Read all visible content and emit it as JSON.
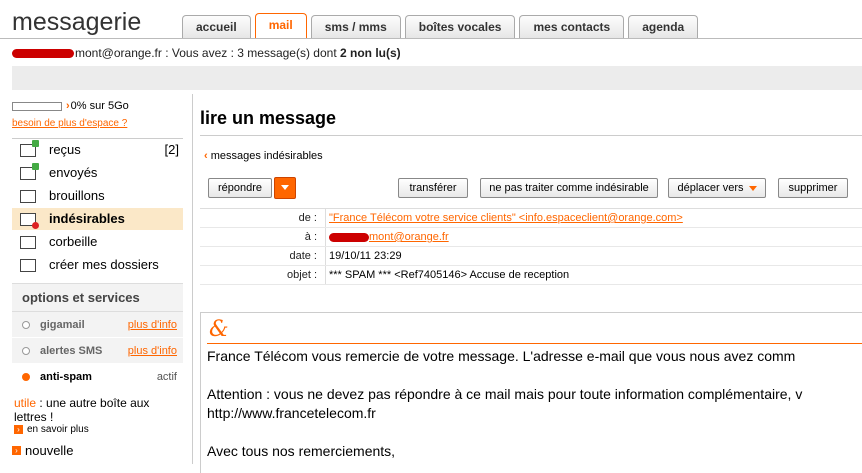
{
  "app": {
    "logo": "messagerie"
  },
  "tabs": [
    "accueil",
    "mail",
    "sms / mms",
    "boîtes vocales",
    "mes contacts",
    "agenda"
  ],
  "active_tab": "mail",
  "user": {
    "email_suffix": "mont@orange.fr",
    "status_text": " : Vous avez : 3 message(s) dont ",
    "unread": "2 non lu(s)"
  },
  "quota": {
    "value": 0,
    "text": "0% sur 5Go",
    "more_link": "besoin de plus d'espace ?"
  },
  "folders": [
    {
      "label": "reçus",
      "count": "[2]",
      "icon": "inbox-icon"
    },
    {
      "label": "envoyés",
      "count": "",
      "icon": "sent-icon"
    },
    {
      "label": "brouillons",
      "count": "",
      "icon": "draft-icon"
    },
    {
      "label": "indésirables",
      "count": "",
      "icon": "spam-icon"
    },
    {
      "label": "corbeille",
      "count": "",
      "icon": "trash-icon"
    },
    {
      "label": "créer mes dossiers",
      "count": "",
      "icon": "folder-icon"
    }
  ],
  "options": {
    "title": "options et services",
    "items": [
      {
        "label": "gigamail",
        "right": "plus d'info"
      },
      {
        "label": "alertes SMS",
        "right": "plus d'info"
      },
      {
        "label": "anti-spam",
        "right": "actif"
      }
    ]
  },
  "promo": {
    "prefix": "utile",
    "text": " : une autre boîte aux lettres !",
    "link": "en savoir plus",
    "next": "nouvelle"
  },
  "message": {
    "page_title": "lire un message",
    "back": "messages indésirables",
    "buttons": {
      "reply": "répondre",
      "forward": "transférer",
      "not_spam": "ne pas traiter comme indésirable",
      "move": "déplacer vers",
      "delete": "supprimer"
    },
    "headers": {
      "de_label": "de :",
      "de_value": "\"France Télécom votre service clients\" <info.espaceclient@orange.com>",
      "a_label": "à :",
      "a_value": "mont@orange.fr",
      "date_label": "date :",
      "date_value": "19/10/11 23:29",
      "objet_label": "objet :",
      "objet_value": "*** SPAM *** <Ref7405146> Accuse de reception"
    },
    "body": {
      "line1": "France Télécom vous remercie de votre message. L'adresse e-mail que vous nous avez comm",
      "line2": "Attention : vous ne devez pas répondre à ce mail mais pour toute information complémentaire, v",
      "line3": "http://www.francetelecom.fr",
      "line4": "Avec tous nos remerciements,"
    }
  }
}
